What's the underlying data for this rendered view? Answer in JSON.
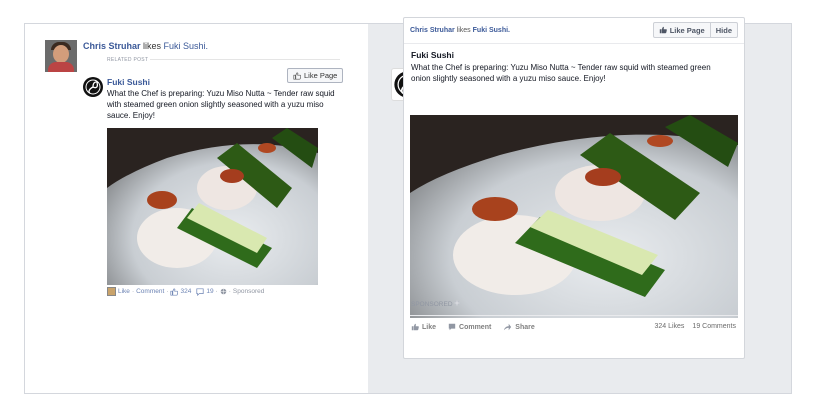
{
  "left_panel": {
    "actor_name": "Chris Struhar",
    "action_text": " likes ",
    "liked_page": "Fuki Sushi.",
    "related_label": "RELATED POST",
    "like_page_label": "Like Page",
    "page_name": "Fuki Sushi",
    "description": "What the Chef is preparing: Yuzu Miso Nutta ~ Tender raw squid with steamed green onion slightly seasoned with a yuzu miso sauce. Enjoy!",
    "actions": {
      "like": "Like",
      "sep1": " · ",
      "comment": "Comment",
      "sep2": " · ",
      "likes_count": "324",
      "comments_count": "19",
      "sep3": " · ",
      "sep4": " · ",
      "sponsored": "Sponsored"
    }
  },
  "right_card": {
    "actor_name": "Chris Struhar",
    "action_text": " likes ",
    "liked_page": "Fuki Sushi.",
    "like_page_label": "Like Page",
    "hide_label": "Hide",
    "page_name": "Fuki Sushi",
    "description": "What the Chef is preparing: Yuzu Miso Nutta ~ Tender raw squid with steamed green onion slightly seasoned with a yuzu miso sauce. Enjoy!",
    "sponsored": "SPONSORED",
    "actions": {
      "like": "Like",
      "comment": "Comment",
      "share": "Share"
    },
    "counts": {
      "likes": "324 Likes",
      "comments": "19 Comments"
    }
  },
  "colors": {
    "link_blue": "#3b5998",
    "panel_bg": "#e9ebee"
  },
  "icons": [
    "fuki-sushi-logo-icon",
    "thumbs-up-icon",
    "comment-icon",
    "share-icon",
    "globe-icon"
  ]
}
